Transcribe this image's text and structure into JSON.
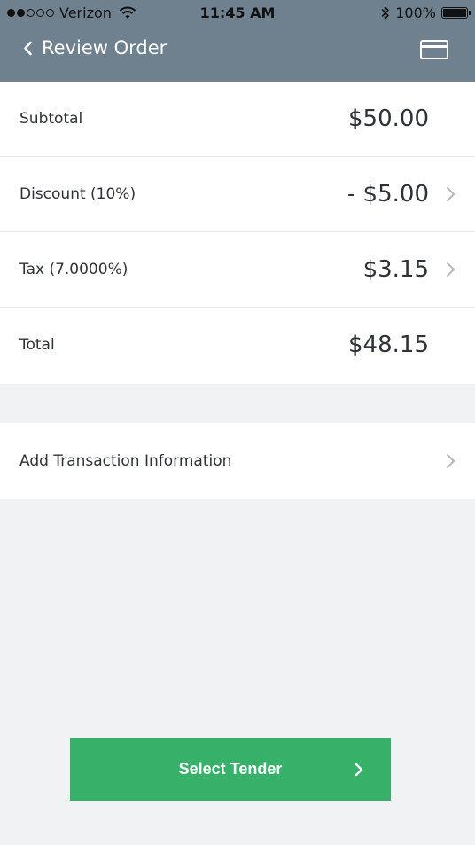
{
  "status_bar": {
    "carrier": "Verizon",
    "time": "11:45 AM",
    "battery": "100%",
    "signal_bars_filled": 2,
    "signal_bars_total": 5,
    "icons": [
      "wifi-icon",
      "bluetooth-icon",
      "battery-icon"
    ]
  },
  "nav": {
    "title": "Review Order",
    "back_icon": "chevron-left-icon",
    "right_icon": "credit-card-icon"
  },
  "summary": {
    "rows": [
      {
        "label": "Subtotal",
        "value": "$50.00",
        "has_chevron": false
      },
      {
        "label": "Discount (10%)",
        "value": "- $5.00",
        "has_chevron": true
      },
      {
        "label": "Tax (7.0000%)",
        "value": "$3.15",
        "has_chevron": true
      },
      {
        "label": "Total",
        "value": "$48.15",
        "has_chevron": false
      }
    ]
  },
  "transaction": {
    "label": "Add Transaction Information"
  },
  "tender_button": {
    "label": "Select Tender"
  },
  "colors": {
    "nav_bg": "#6f818f",
    "page_bg": "#f1f2f4",
    "button_bg": "#37b06a",
    "text": "#2f3236",
    "chevron": "#b3b7bb"
  }
}
